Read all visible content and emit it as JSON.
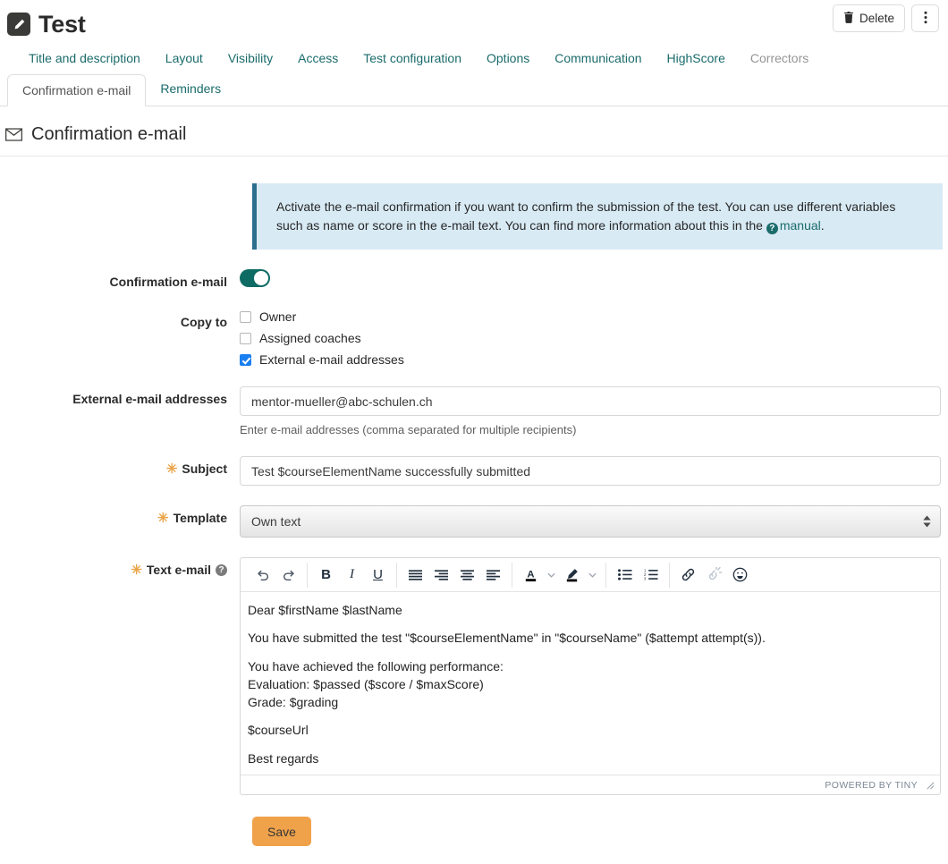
{
  "header": {
    "title": "Test",
    "title_icon": "pencil-icon",
    "delete_label": "Delete",
    "delete_icon": "trash-icon",
    "more_icon": "kebab-menu-icon"
  },
  "nav_primary": [
    {
      "label": "Title and description",
      "disabled": false
    },
    {
      "label": "Layout",
      "disabled": false
    },
    {
      "label": "Visibility",
      "disabled": false
    },
    {
      "label": "Access",
      "disabled": false
    },
    {
      "label": "Test configuration",
      "disabled": false
    },
    {
      "label": "Options",
      "disabled": false
    },
    {
      "label": "Communication",
      "disabled": false
    },
    {
      "label": "HighScore",
      "disabled": false
    },
    {
      "label": "Correctors",
      "disabled": true
    }
  ],
  "nav_secondary": [
    {
      "label": "Confirmation e-mail",
      "active": true
    },
    {
      "label": "Reminders",
      "active": false
    }
  ],
  "section": {
    "title": "Confirmation e-mail",
    "icon": "envelope-icon"
  },
  "info_banner": {
    "text_before_link": "Activate the e-mail confirmation if you want to confirm the submission of the test. You can use different variables such as name or score in the e-mail text. You can find more information about this in the ",
    "link_label": "manual",
    "link_icon": "help-circle-icon",
    "text_after_link": ".",
    "accent_color": "#2c6e8e",
    "background_color": "#d8eaf4"
  },
  "form": {
    "confirmation": {
      "label": "Confirmation e-mail",
      "toggle_on": true,
      "toggle_color": "#0e6b64"
    },
    "copy_to": {
      "label": "Copy to",
      "options": [
        {
          "label": "Owner",
          "checked": false
        },
        {
          "label": "Assigned coaches",
          "checked": false
        },
        {
          "label": "External e-mail addresses",
          "checked": true
        }
      ]
    },
    "external_addresses": {
      "label": "External e-mail addresses",
      "value": "mentor-mueller@abc-schulen.ch",
      "hint": "Enter e-mail addresses (comma separated for multiple recipients)"
    },
    "subject": {
      "label": "Subject",
      "required": true,
      "value": "Test $courseElementName successfully submitted"
    },
    "template": {
      "label": "Template",
      "required": true,
      "value": "Own text"
    },
    "text_email": {
      "label": "Text e-mail",
      "required": true,
      "help_icon": "question-circle-icon",
      "paragraphs": [
        "Dear $firstName $lastName",
        "You have submitted the test \"$courseElementName\" in \"$courseName\" ($attempt attempt(s)).",
        "You have achieved the following performance:\nEvaluation: $passed ($score / $maxScore)\nGrade: $grading",
        "$courseUrl",
        "Best regards"
      ],
      "status_text": "POWERED BY TINY"
    }
  },
  "toolbar": {
    "groups": [
      {
        "items": [
          {
            "name": "undo-icon",
            "glyph": "↶",
            "disabled": false
          },
          {
            "name": "redo-icon",
            "glyph": "↷",
            "disabled": false
          }
        ]
      },
      {
        "items": [
          {
            "name": "bold-icon",
            "glyph": "B",
            "disabled": false
          },
          {
            "name": "italic-icon",
            "glyph": "I",
            "disabled": false
          },
          {
            "name": "underline-icon",
            "glyph": "U",
            "disabled": false
          }
        ]
      },
      {
        "items": [
          {
            "name": "align-justify-icon",
            "glyph": "",
            "disabled": false
          },
          {
            "name": "align-right-icon",
            "glyph": "",
            "disabled": false
          },
          {
            "name": "align-center-icon",
            "glyph": "",
            "disabled": false
          },
          {
            "name": "align-left-icon",
            "glyph": "",
            "disabled": false
          }
        ]
      },
      {
        "items": [
          {
            "name": "text-color-icon",
            "glyph": "A",
            "disabled": false
          },
          {
            "name": "text-color-caret-icon",
            "glyph": "⌄",
            "disabled": false
          },
          {
            "name": "highlight-color-icon",
            "glyph": "",
            "disabled": false
          },
          {
            "name": "highlight-color-caret-icon",
            "glyph": "⌄",
            "disabled": false
          }
        ]
      },
      {
        "items": [
          {
            "name": "bullet-list-icon",
            "glyph": "",
            "disabled": false
          },
          {
            "name": "numbered-list-icon",
            "glyph": "",
            "disabled": false
          }
        ]
      },
      {
        "items": [
          {
            "name": "link-icon",
            "glyph": "",
            "disabled": false
          },
          {
            "name": "unlink-icon",
            "glyph": "",
            "disabled": true
          },
          {
            "name": "emoji-icon",
            "glyph": "",
            "disabled": false
          }
        ]
      }
    ]
  },
  "actions": {
    "save_label": "Save",
    "save_color": "#f0a24a"
  }
}
